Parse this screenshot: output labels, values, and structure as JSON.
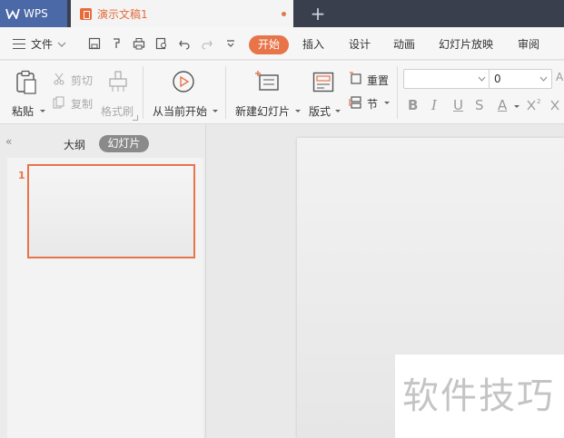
{
  "titlebar": {
    "app_tab": "WPS",
    "doc_tab": "演示文稿1",
    "new_tab": "+"
  },
  "menubar": {
    "file": "文件",
    "tabs": [
      "开始",
      "插入",
      "设计",
      "动画",
      "幻灯片放映",
      "审阅"
    ]
  },
  "ribbon": {
    "paste": "粘贴",
    "cut": "剪切",
    "copy": "复制",
    "format_painter": "格式刷",
    "play_from_current": "从当前开始",
    "new_slide": "新建幻灯片",
    "layout": "版式",
    "reset": "重置",
    "section": "节",
    "font_size": "0",
    "format_buttons": [
      "B",
      "I",
      "U",
      "S",
      "A"
    ]
  },
  "panel": {
    "collapse": "«",
    "tab_outline": "大纲",
    "tab_slides": "幻灯片",
    "slide_number": "1"
  },
  "watermark": "软件技巧",
  "colors": {
    "accent": "#e8744a",
    "titlebar": "#3a3f4e",
    "wps_tab": "#4b69a6"
  }
}
